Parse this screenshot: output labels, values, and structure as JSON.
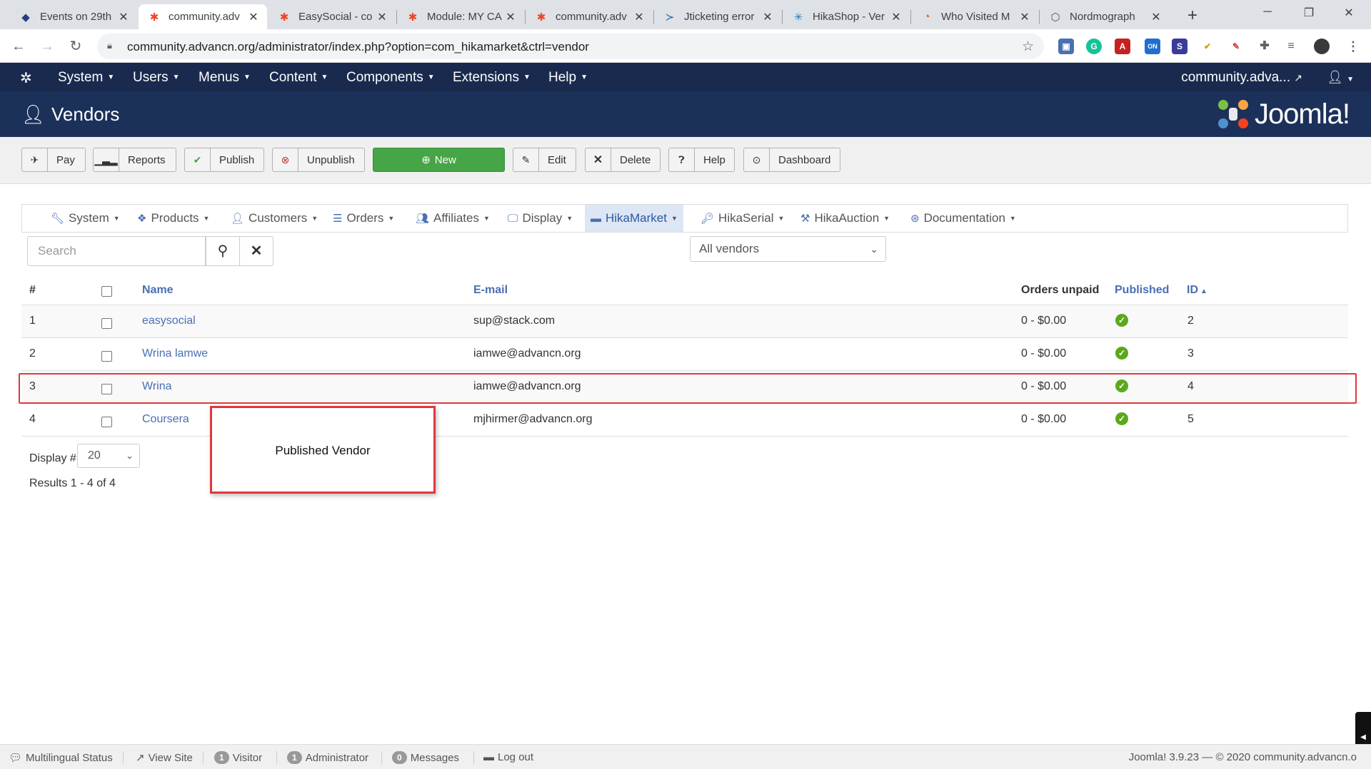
{
  "browser": {
    "tabs": [
      {
        "label": "Events on 29th",
        "icon": "diamond-icon"
      },
      {
        "label": "community.adv",
        "icon": "joomla-icon",
        "active": true
      },
      {
        "label": "EasySocial - co",
        "icon": "joomla-icon"
      },
      {
        "label": "Module: MY CA",
        "icon": "joomla-icon"
      },
      {
        "label": "community.adv",
        "icon": "joomla-icon"
      },
      {
        "label": "Jticketing error",
        "icon": "tjoomla-icon"
      },
      {
        "label": "HikaShop - Ver",
        "icon": "hikashop-icon"
      },
      {
        "label": "Who Visited M",
        "icon": "circle-icon"
      },
      {
        "label": "Nordmograph",
        "icon": "hexagon-icon"
      }
    ],
    "url": "community.advancn.org/administrator/index.php?option=com_hikamarket&ctrl=vendor"
  },
  "jnav": {
    "menus": [
      "System",
      "Users",
      "Menus",
      "Content",
      "Components",
      "Extensions",
      "Help"
    ],
    "site": "community.adva..."
  },
  "page": {
    "title": "Vendors",
    "brand": "Joomla!"
  },
  "toolbar": {
    "buttons": [
      "Pay",
      "Reports",
      "Publish",
      "Unpublish",
      "New",
      "Edit",
      "Delete",
      "Help",
      "Dashboard"
    ]
  },
  "hikamenu": {
    "items": [
      "System",
      "Products",
      "Customers",
      "Orders",
      "Affiliates",
      "Display",
      "HikaMarket",
      "HikaSerial",
      "HikaAuction",
      "Documentation"
    ]
  },
  "filters": {
    "search_placeholder": "Search",
    "vendor_filter": "All vendors"
  },
  "table": {
    "headers": {
      "num": "#",
      "name": "Name",
      "email": "E-mail",
      "orders_unpaid": "Orders unpaid",
      "published": "Published",
      "id": "ID"
    },
    "rows": [
      {
        "num": "1",
        "name": "easysocial",
        "email": "sup@stack.com",
        "orders_unpaid": "0 - $0.00",
        "published": true,
        "id": "2"
      },
      {
        "num": "2",
        "name": "Wrina lamwe",
        "email": "iamwe@advancn.org",
        "orders_unpaid": "0 - $0.00",
        "published": true,
        "id": "3"
      },
      {
        "num": "3",
        "name": "Wrina",
        "email": "iamwe@advancn.org",
        "orders_unpaid": "0 - $0.00",
        "published": true,
        "id": "4"
      },
      {
        "num": "4",
        "name": "Coursera",
        "email": "mjhirmer@advancn.org",
        "orders_unpaid": "0 - $0.00",
        "published": true,
        "id": "5"
      }
    ]
  },
  "callout": {
    "text": "Published Vendor"
  },
  "pagination": {
    "display_label": "Display #",
    "display_value": "20",
    "results": "Results 1 - 4 of 4"
  },
  "statusbar": {
    "multilingual": "Multilingual Status",
    "view_site": "View Site",
    "visitor_count": "1",
    "visitor_label": "Visitor",
    "admin_count": "1",
    "admin_label": "Administrator",
    "messages_count": "0",
    "messages_label": "Messages",
    "logout": "Log out",
    "footer": "Joomla! 3.9.23 — © 2020 community.advancn.o"
  },
  "colors": {
    "header_dark": "#1a2a4e",
    "title_bar": "#1c3159",
    "new_button": "#46a546",
    "link": "#4a6fb3",
    "highlight": "#e0383e",
    "published": "#5ba91b"
  }
}
